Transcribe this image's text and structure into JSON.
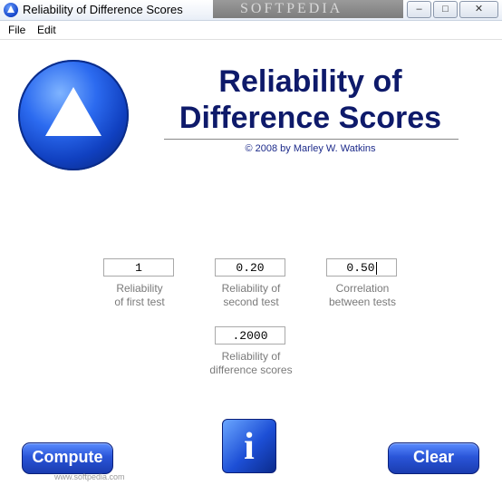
{
  "window": {
    "title": "Reliability of Difference Scores",
    "watermark": "SOFTPEDIA",
    "buttons": {
      "minimize": "–",
      "maximize": "□",
      "close": "✕"
    }
  },
  "menu": {
    "items": [
      "File",
      "Edit"
    ]
  },
  "logo": {
    "icon": "triangle-logo-icon"
  },
  "header": {
    "title": "Reliability of\nDifference Scores",
    "copyright": "© 2008 by Marley W. Watkins"
  },
  "fields": {
    "first_test": {
      "value": "1",
      "label": "Reliability\nof first test"
    },
    "second_test": {
      "value": "0.20",
      "label": "Reliability of\nsecond test"
    },
    "correlation": {
      "value": "0.50",
      "label": "Correlation\nbetween tests"
    },
    "difference": {
      "value": ".2000",
      "label": "Reliability of\ndifference scores"
    }
  },
  "actions": {
    "compute": "Compute",
    "clear": "Clear",
    "info": "i"
  },
  "footer": {
    "watermark": "www.softpedia.com"
  }
}
